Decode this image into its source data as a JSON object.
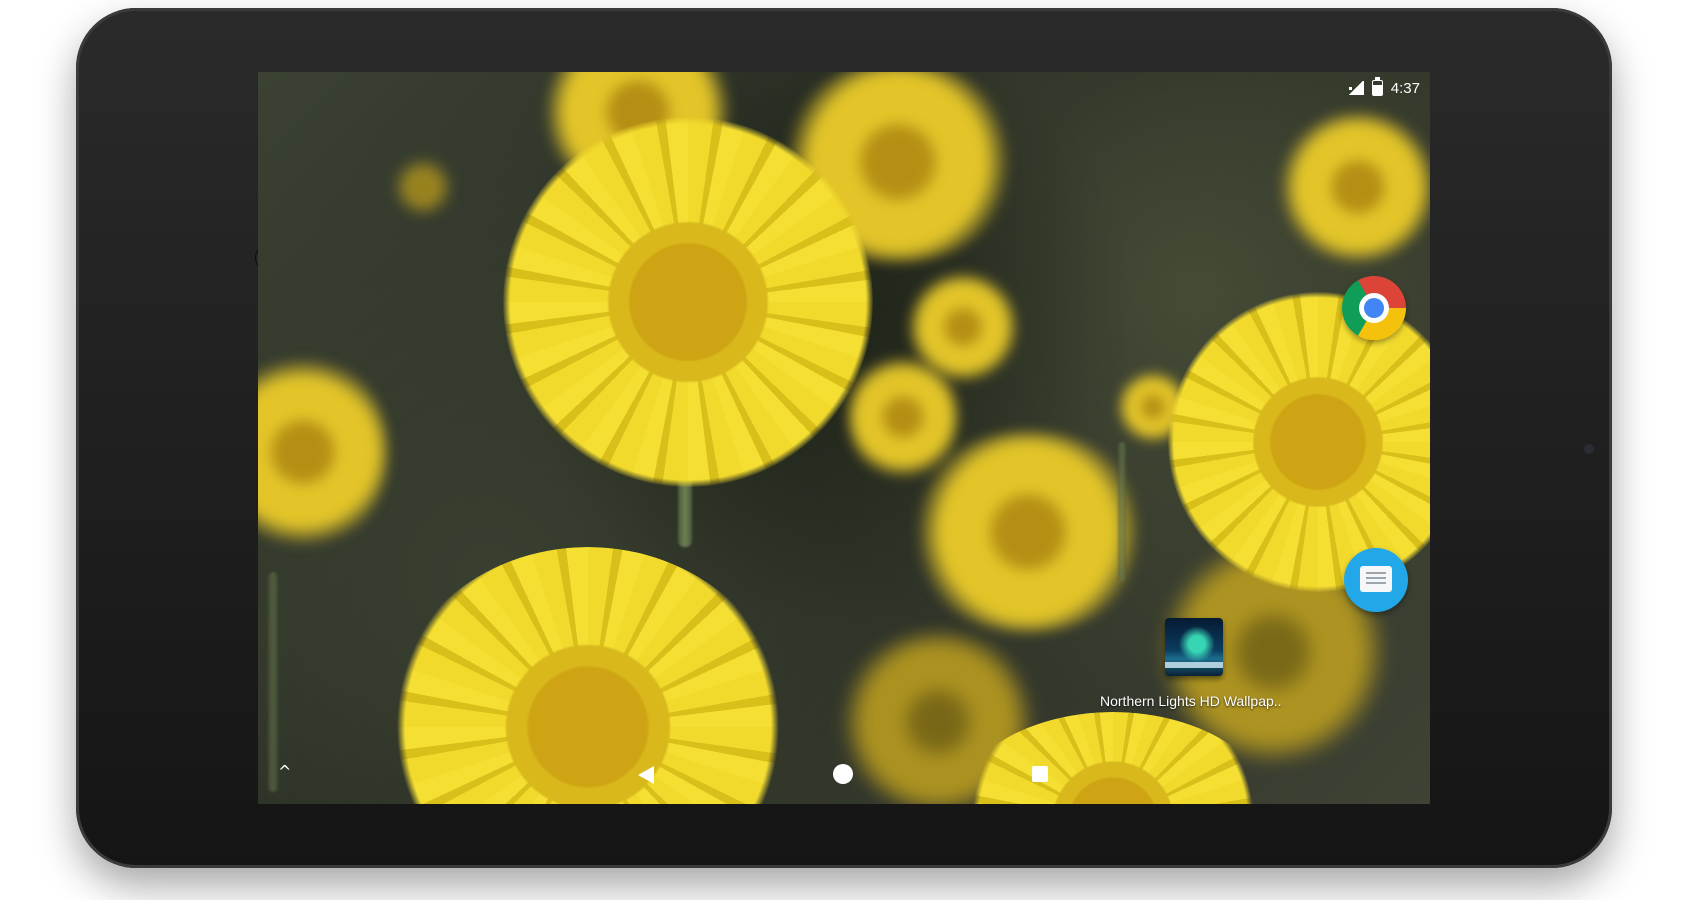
{
  "status_bar": {
    "time": "4:37",
    "icons": [
      "signal-icon",
      "battery-icon"
    ]
  },
  "home_screen": {
    "apps": [
      {
        "name": "chrome-icon",
        "label": ""
      },
      {
        "name": "messages-icon",
        "label": ""
      },
      {
        "name": "northern-lights-hd-wallpaper-icon",
        "label": "Northern Lights HD Wallpap.."
      }
    ]
  },
  "nav_bar": {
    "icons": [
      "chevron-up-icon",
      "back-icon",
      "home-icon",
      "recents-icon"
    ],
    "up_glyph": "^"
  },
  "colors": {
    "chrome_red": "#db4437",
    "chrome_yellow": "#f4c20d",
    "chrome_green": "#0f9d58",
    "chrome_blue": "#4285f4",
    "messages_blue": "#22a7e8",
    "flower_yellow": "#f2da2c"
  }
}
